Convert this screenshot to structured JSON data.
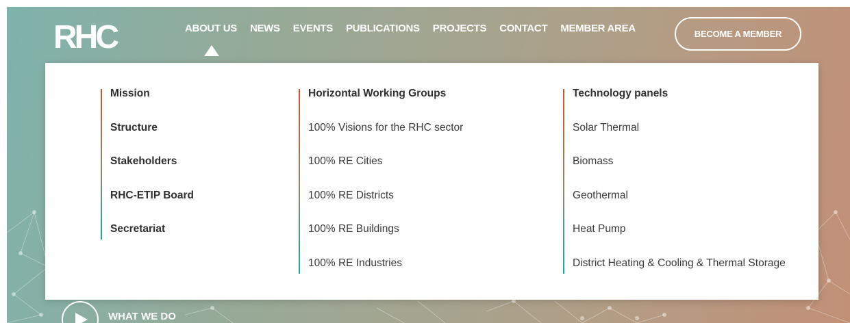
{
  "logo": {
    "text": "RHC"
  },
  "nav": {
    "items": [
      "ABOUT US",
      "NEWS",
      "EVENTS",
      "PUBLICATIONS",
      "PROJECTS",
      "CONTACT",
      "MEMBER AREA"
    ],
    "cta": "BECOME A MEMBER"
  },
  "dropdown": {
    "col1": [
      "Mission",
      "Structure",
      "Stakeholders",
      "RHC-ETIP Board",
      "Secretariat"
    ],
    "col2": {
      "heading": "Horizontal Working Groups",
      "items": [
        "100% Visions for the RHC sector",
        "100% RE Cities",
        "100% RE Districts",
        "100% RE Buildings",
        "100% RE Industries"
      ]
    },
    "col3": {
      "heading": "Technology panels",
      "items": [
        "Solar Thermal",
        "Biomass",
        "Geothermal",
        "Heat Pump",
        "District Heating & Cooling & Thermal Storage"
      ]
    }
  },
  "what_we_do": {
    "label": "WHAT WE DO",
    "icon": "play-icon"
  },
  "colors": {
    "accent_top": "#d0522c",
    "accent_bottom": "#16a7a4",
    "bg_left": "#7fb3ad",
    "bg_right": "#c18f76"
  }
}
